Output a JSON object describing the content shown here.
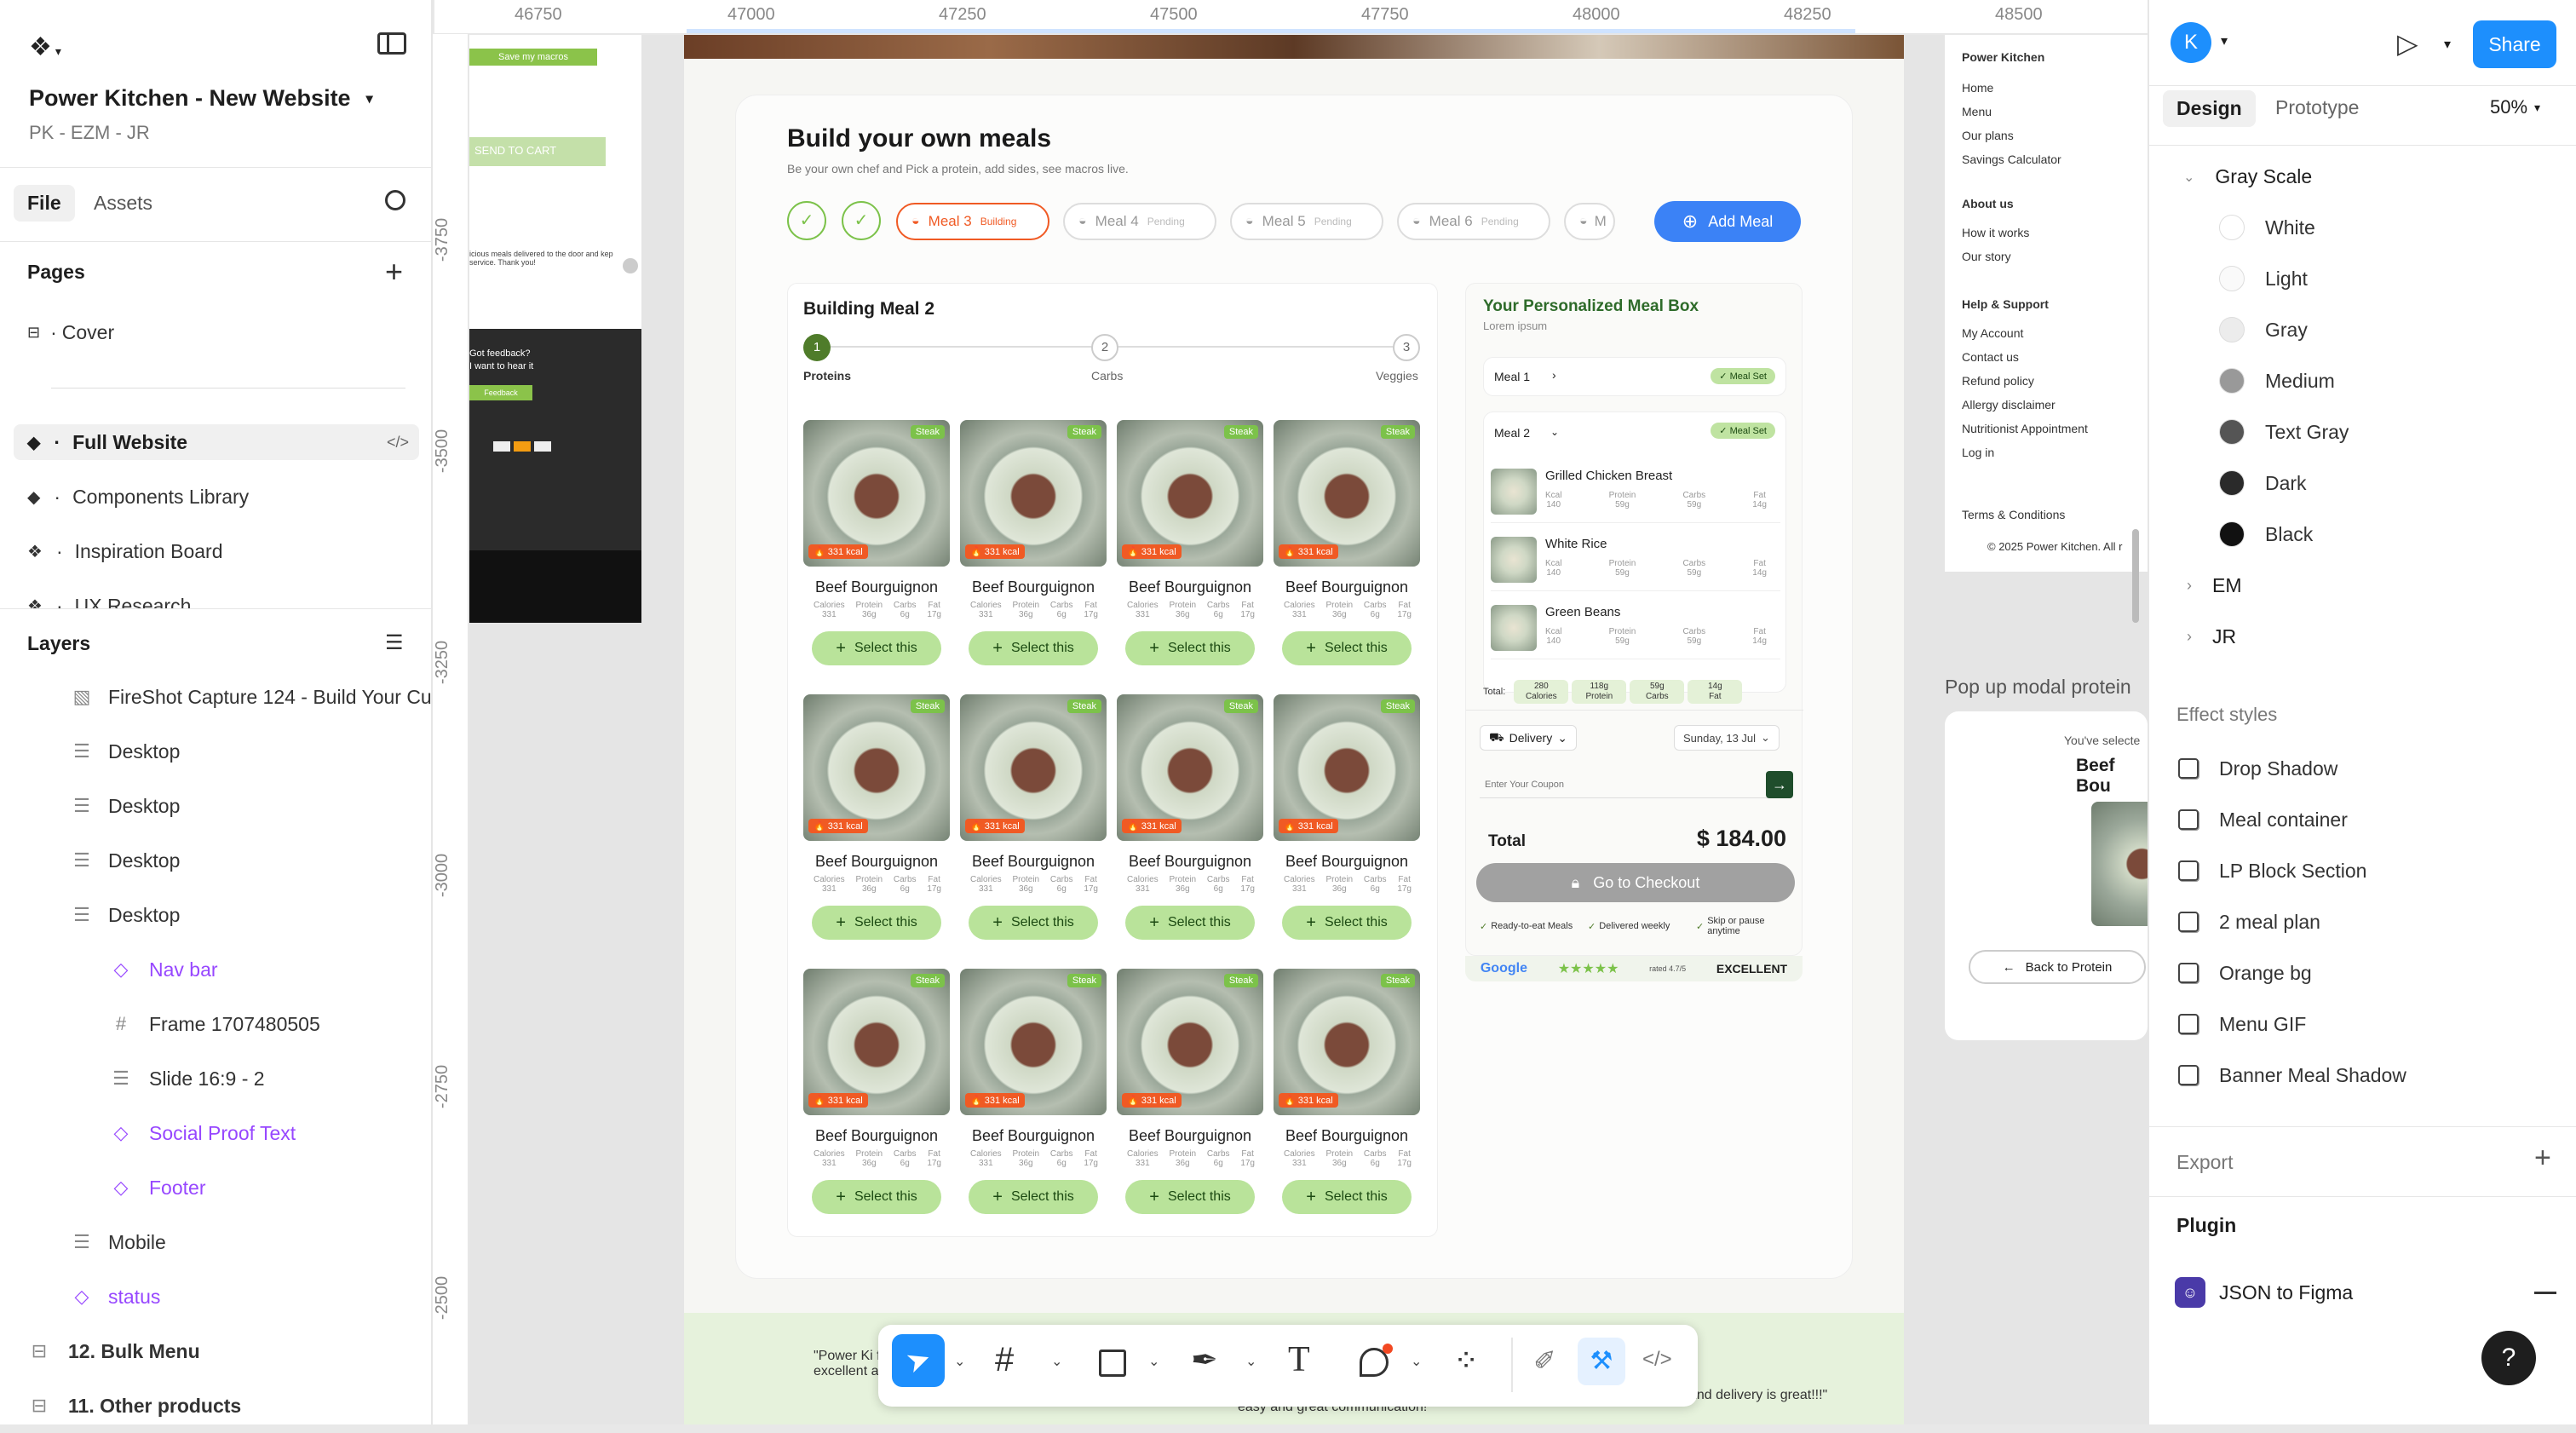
{
  "left_panel": {
    "project_title": "Power Kitchen - New Website",
    "project_subtitle": "PK - EZM - JR",
    "tabs": {
      "file": "File",
      "assets": "Assets"
    },
    "pages_heading": "Pages",
    "pages": [
      {
        "label": "Cover",
        "icon": "page-icon"
      },
      {
        "label": "Full Website",
        "icon": "diamond-icon"
      },
      {
        "label": "Components Library",
        "icon": "diamond-icon"
      },
      {
        "label": "Inspiration Board",
        "icon": "component-set-icon"
      },
      {
        "label": "UX Research",
        "icon": "component-set-icon"
      }
    ],
    "layers_heading": "Layers",
    "layers": [
      {
        "label": "FireShot Capture 124 - Build Your Cu",
        "icon": "image-icon"
      },
      {
        "label": "Desktop",
        "icon": "section-icon"
      },
      {
        "label": "Desktop",
        "icon": "section-icon"
      },
      {
        "label": "Desktop",
        "icon": "section-icon"
      },
      {
        "label": "Desktop",
        "icon": "section-icon"
      },
      {
        "label": "Nav bar",
        "icon": "instance-icon"
      },
      {
        "label": "Frame 1707480505",
        "icon": "frame-icon"
      },
      {
        "label": "Slide 16:9 - 2",
        "icon": "section-icon"
      },
      {
        "label": "Social Proof Text",
        "icon": "instance-icon"
      },
      {
        "label": "Footer",
        "icon": "instance-icon"
      },
      {
        "label": "Mobile",
        "icon": "section-icon"
      },
      {
        "label": "status",
        "icon": "instance-icon"
      },
      {
        "label": "12. Bulk Menu",
        "icon": "page-icon"
      },
      {
        "label": "11. Other products",
        "icon": "page-icon"
      }
    ]
  },
  "ruler": {
    "top": [
      "46750",
      "47000",
      "47250",
      "47500",
      "47750",
      "48000",
      "48250",
      "48500"
    ],
    "left": [
      "-3750",
      "-3500",
      "-3250",
      "-3000",
      "-2750",
      "-2500"
    ]
  },
  "right_panel": {
    "avatar_initial": "K",
    "share_label": "Share",
    "tabs": {
      "design": "Design",
      "prototype": "Prototype"
    },
    "zoom": "50%",
    "gray_scale_heading": "Gray Scale",
    "colors": [
      {
        "name": "White",
        "hex": "#ffffff"
      },
      {
        "name": "Light",
        "hex": "#fafafa"
      },
      {
        "name": "Gray",
        "hex": "#ececec"
      },
      {
        "name": "Medium",
        "hex": "#999999"
      },
      {
        "name": "Text Gray",
        "hex": "#555555"
      },
      {
        "name": "Dark",
        "hex": "#2a2a2a"
      },
      {
        "name": "Black",
        "hex": "#111111"
      }
    ],
    "groups": [
      "EM",
      "JR"
    ],
    "effect_styles_heading": "Effect styles",
    "effects": [
      "Drop Shadow",
      "Meal container",
      "LP Block Section",
      "2 meal plan",
      "Orange bg",
      "Menu GIF",
      "Banner Meal Shadow"
    ],
    "export_heading": "Export",
    "plugin_heading": "Plugin",
    "plugin_name": "JSON to Figma",
    "help": "?"
  },
  "canvas": {
    "save_macros": "Save my macros",
    "send_to_cart": "SEND TO CART",
    "feedback_lines": [
      "Got feedback?",
      "I want to hear it"
    ],
    "feedback_btn": "Feedback",
    "delivery_note": "icious meals delivered to the door and kep service. Thank you!",
    "builder": {
      "title": "Build your own meals",
      "subtitle": "Be your own chef and Pick a protein, add sides, see macros live.",
      "meal_pills": [
        {
          "label": "Meal 3",
          "state": "Building"
        },
        {
          "label": "Meal 4",
          "state": "Pending"
        },
        {
          "label": "Meal 5",
          "state": "Pending"
        },
        {
          "label": "Meal 6",
          "state": "Pending"
        },
        {
          "label": "M",
          "state": ""
        }
      ],
      "add_meal": "Add Meal",
      "building_title": "Building Meal 2",
      "steps": [
        {
          "num": "1",
          "label": "Proteins"
        },
        {
          "num": "2",
          "label": "Carbs"
        },
        {
          "num": "3",
          "label": "Veggies"
        }
      ],
      "food_item": {
        "name": "Beef Bourguignon",
        "tag": "Steak",
        "kcal": "331 kcal",
        "macros": [
          {
            "label": "Calories",
            "value": "331"
          },
          {
            "label": "Protein",
            "value": "36g"
          },
          {
            "label": "Carbs",
            "value": "6g"
          },
          {
            "label": "Fat",
            "value": "17g"
          }
        ],
        "select": "Select this"
      },
      "box": {
        "title": "Your Personalized Meal Box",
        "subtitle": "Lorem ipsum",
        "meal1": "Meal 1",
        "meal2": "Meal 2",
        "meal_set": "Meal Set",
        "items": [
          {
            "name": "Grilled Chicken Breast",
            "kcal": "140",
            "protein": "59g",
            "carbs": "59g",
            "fat": "14g"
          },
          {
            "name": "White Rice",
            "kcal": "140",
            "protein": "59g",
            "carbs": "59g",
            "fat": "14g"
          },
          {
            "name": "Green Beans",
            "kcal": "140",
            "protein": "59g",
            "carbs": "59g",
            "fat": "14g"
          }
        ],
        "total_label": "Total:",
        "totals": [
          {
            "value": "280",
            "label": "Calories"
          },
          {
            "value": "118g",
            "label": "Protein"
          },
          {
            "value": "59g",
            "label": "Carbs"
          },
          {
            "value": "14g",
            "label": "Fat"
          }
        ],
        "delivery": "Delivery",
        "date": "Sunday, 13 Jul",
        "coupon_placeholder": "Enter Your Coupon",
        "total": "Total",
        "price": "$ 184.00",
        "checkout": "Go to Checkout",
        "perks": [
          "Ready-to-eat Meals",
          "Delivered weekly",
          "Skip or pause anytime"
        ],
        "google": "Google",
        "stars": "★★★★★",
        "rated": "rated 4.7/5",
        "excellent": "EXCELLENT"
      }
    },
    "footer_links": {
      "brand": "Power Kitchen",
      "main": [
        "Home",
        "Menu",
        "Our plans",
        "Savings Calculator"
      ],
      "about_heading": "About us",
      "about": [
        "How it works",
        "Our story"
      ],
      "help_heading": "Help & Support",
      "help": [
        "My Account",
        "Contact us",
        "Refund policy",
        "Allergy disclaimer",
        "Nutritionist Appointment",
        "Log in"
      ],
      "terms": "Terms & Conditions",
      "copyright": "© 2025 Power Kitchen. All r"
    },
    "popup": {
      "label": "Pop up modal protein",
      "selected": "You've selecte",
      "name": "Beef Bou",
      "back": "Back to Protein"
    },
    "testimonials": [
      "\"Power Ki food that satisfactory. Delivery is excellent and on time.\"",
      "easy and great communication!",
      "and delivery is great!!!\""
    ]
  }
}
